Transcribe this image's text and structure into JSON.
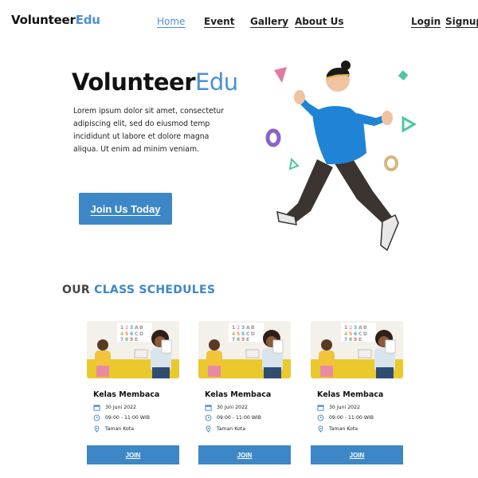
{
  "header": {
    "brand": {
      "part1": "Volunteer",
      "part2": "Edu"
    },
    "nav": [
      {
        "label": "Home",
        "active": true
      },
      {
        "label": "Event"
      },
      {
        "label": "Gallery"
      },
      {
        "label": "About Us"
      }
    ],
    "login_label": "Login",
    "signup_label": "Signup"
  },
  "hero": {
    "title_part1": "Volunteer",
    "title_part2": "Edu",
    "description": "Lorem ipsum dolor sit amet, consectetur adipiscing elit, sed do eiusmod temp incididunt ut labore et dolore magna aliqua. Ut enim ad minim veniam.",
    "cta_label": "Join Us Today"
  },
  "schedules": {
    "title_part1": "OUR",
    "title_part2": "CLASS SCHEDULES",
    "cards": [
      {
        "name": "Kelas Membaca",
        "date": "30 Juni 2022",
        "time": "09:00 - 11:00 WIB",
        "location": "Taman Kota",
        "join_label": "JOIN"
      },
      {
        "name": "Kelas Membaca",
        "date": "30 Juni 2022",
        "time": "09:00 - 11:00 WIB",
        "location": "Taman Kota",
        "join_label": "JOIN"
      },
      {
        "name": "Kelas Membaca",
        "date": "30 Juni 2022",
        "time": "09:00 - 11:00 WIB",
        "location": "Taman Kota",
        "join_label": "JOIN"
      }
    ]
  },
  "colors": {
    "accent": "#4a8fd8",
    "button": "#3d87c7",
    "icon": "#3d87c7"
  },
  "icons": {
    "date": "calendar-icon",
    "time": "clock-icon",
    "location": "location-pin-icon"
  }
}
